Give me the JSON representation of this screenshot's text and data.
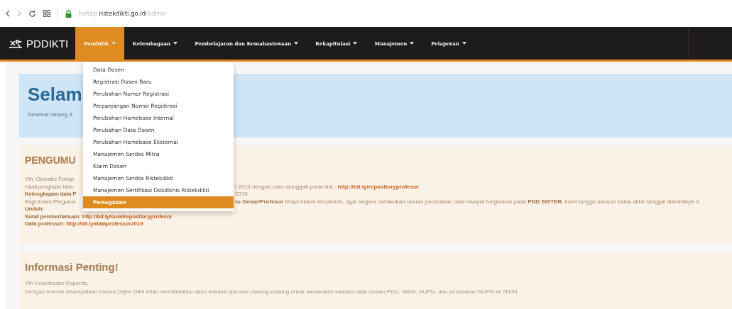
{
  "browser": {
    "url_parts": [
      {
        "text": "fortap.",
        "kind": "dim"
      },
      {
        "text": "ristekdikti.go.id",
        "kind": "main"
      },
      {
        "text": "/admin",
        "kind": "dim"
      }
    ]
  },
  "navbar": {
    "brand": "PDDIKTI",
    "items": [
      {
        "label": "Pendidik",
        "selected": true
      },
      {
        "label": "Kelembagaan",
        "selected": false
      },
      {
        "label": "Pembelajaran dan Kemahasiswaan",
        "selected": false
      },
      {
        "label": "Rekapitulasi",
        "selected": false
      },
      {
        "label": "Manajemen",
        "selected": false
      },
      {
        "label": "Pelaporan",
        "selected": false
      }
    ]
  },
  "dropdown": {
    "items": [
      {
        "label": "Data Dosen",
        "selected": false
      },
      {
        "label": "Registrasi Dosen Baru",
        "selected": false
      },
      {
        "label": "Perubahan Nomor Registrasi",
        "selected": false
      },
      {
        "label": "Perpanjangan Nomor Registrasi",
        "selected": false
      },
      {
        "label": "Perubahan Homebase Internal",
        "selected": false
      },
      {
        "label": "Perubahan Data Dosen",
        "selected": false
      },
      {
        "label": "Perubahan Homebase Eksternal",
        "selected": false
      },
      {
        "label": "Manajemen Serdos Mitra",
        "selected": false
      },
      {
        "label": "Klaim Dosen",
        "selected": false
      },
      {
        "label": "Manajemen Serdos Ristekdikti",
        "selected": false
      },
      {
        "label": "Manajemen Sertifikasi Dokdiknis Ristekdikti",
        "selected": false
      },
      {
        "label": "Penugasan",
        "selected": true
      }
    ]
  },
  "welcome": {
    "title": "Selam",
    "subtitle": "Selamat datang d"
  },
  "announcement": {
    "title": "PENGUMU",
    "lines": [
      {
        "before": [
          {
            "text": "Yth, Operator Fortap",
            "kind": "plain"
          }
        ]
      },
      {
        "before": [
          {
            "text": "Hasil pengisian bida",
            "kind": "plain"
          }
        ],
        "after": [
          {
            "text": "l 2019 dengan cara diunggah pada link : ",
            "kind": "plain"
          },
          {
            "text": "http://bit.ly/repositoryprofesor",
            "kind": "link"
          }
        ]
      },
      {
        "before": [
          {
            "text": "Kelengkapan data P",
            "kind": "bold"
          }
        ],
        "after": [
          {
            "text": "2019.",
            "kind": "plain"
          }
        ]
      },
      {
        "before": [
          {
            "text": "Bagi dosen Pergurua",
            "kind": "plain"
          }
        ],
        "after": [
          {
            "text": "ru Gesar/Profesor",
            "kind": "bold"
          },
          {
            "text": " tetapi belum tercantum, agar segera melakukan usulan perubahan data riwayat fungsional pada ",
            "kind": "plain"
          },
          {
            "text": "PDD SISTER",
            "kind": "bold"
          },
          {
            "text": ", kami tunggu sampai batas akhir tanggal diambilnya d",
            "kind": "plain"
          }
        ]
      },
      {
        "before": [
          {
            "text": "Unduh:",
            "kind": "bold"
          }
        ]
      },
      {
        "before": [
          {
            "text": "Surat pemberitahuan: ",
            "kind": "bold"
          },
          {
            "text": "http://bit.ly/suratrepositoryprofesor",
            "kind": "link"
          }
        ]
      },
      {
        "before": [
          {
            "text": "Data professor: ",
            "kind": "bold"
          },
          {
            "text": "http://bit.ly/dataprofessor2019",
            "kind": "link"
          }
        ]
      }
    ]
  },
  "info": {
    "title": "Informasi Penting!",
    "lines": [
      "Yth Koordinator Kopertis,",
      "Dengan hormat disampaikan bahwa Ditjen Dikti telah memfasilitasi akun melalui operator masing-masing untuk melakukan validasi data usulan PDD, NIDN, NUPN, dan perubahan NUPN ke NIDN."
    ]
  }
}
